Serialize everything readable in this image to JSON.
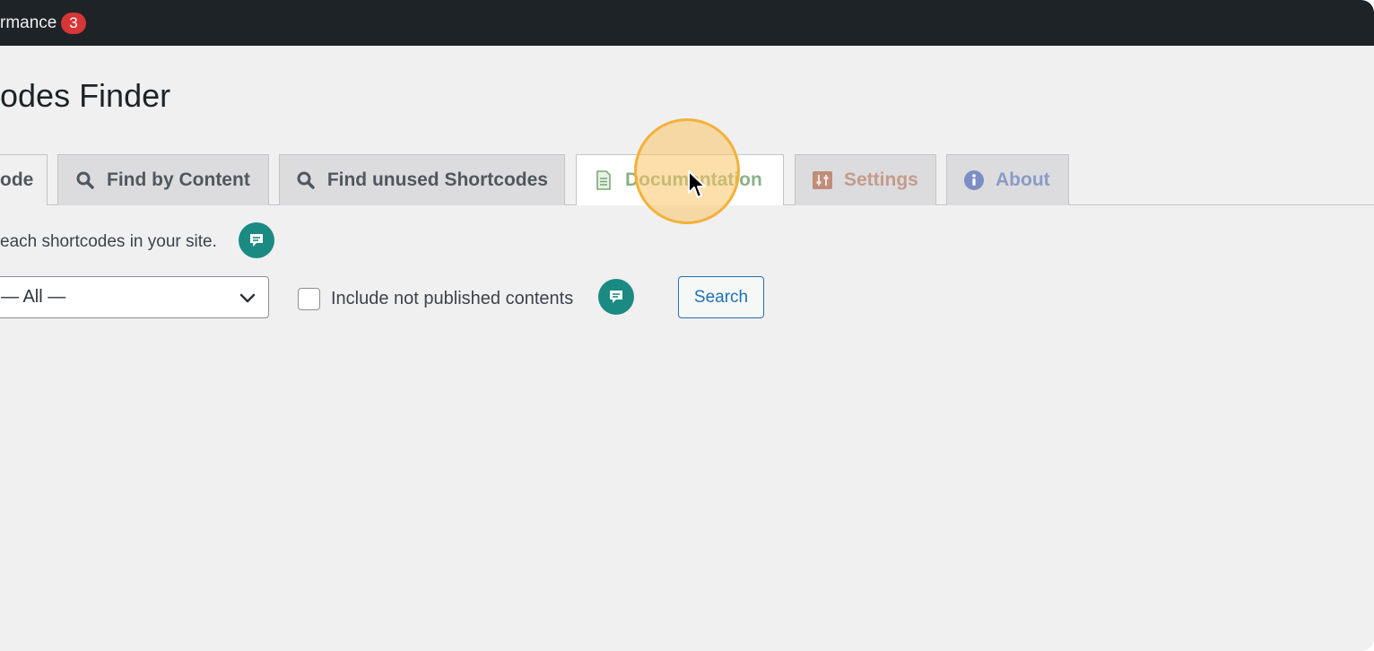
{
  "admin_bar": {
    "label": "rmance",
    "badge_count": "3"
  },
  "page": {
    "title": "odes Finder",
    "description": "each shortcodes in your site."
  },
  "tabs": [
    {
      "label": "ode",
      "icon": "none",
      "active": true
    },
    {
      "label": "Find by Content",
      "icon": "search-icon"
    },
    {
      "label": "Find unused Shortcodes",
      "icon": "search-icon"
    },
    {
      "label": "Documentation",
      "icon": "document-icon"
    },
    {
      "label": "Settings",
      "icon": "settings-icon"
    },
    {
      "label": "About",
      "icon": "info-icon"
    }
  ],
  "form": {
    "post_type_select": {
      "selected": "— All —"
    },
    "include_unpublished_label": "Include not published contents",
    "include_unpublished_checked": false,
    "search_label": "Search"
  },
  "colors": {
    "admin_bar_bg": "#1d2327",
    "badge": "#d63638",
    "help_bubble": "#1a8a83",
    "primary": "#2271b1",
    "highlight": "#f2b13a"
  }
}
